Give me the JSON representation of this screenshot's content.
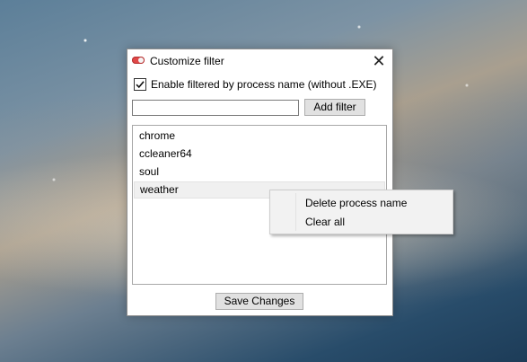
{
  "window": {
    "title": "Customize filter",
    "close_glyph": "✕",
    "app_icon": "toggle-switch-icon"
  },
  "filter_toggle": {
    "label": "Enable filtered by process name (without .EXE)",
    "checked": true
  },
  "filter_input": {
    "value": "",
    "placeholder": ""
  },
  "add_filter_label": "Add filter",
  "process_list": {
    "items": [
      "chrome",
      "ccleaner64",
      "soul",
      "weather"
    ],
    "selected_index": 3
  },
  "context_menu": {
    "items": [
      "Delete process name",
      "Clear all"
    ]
  },
  "save_label": "Save Changes"
}
